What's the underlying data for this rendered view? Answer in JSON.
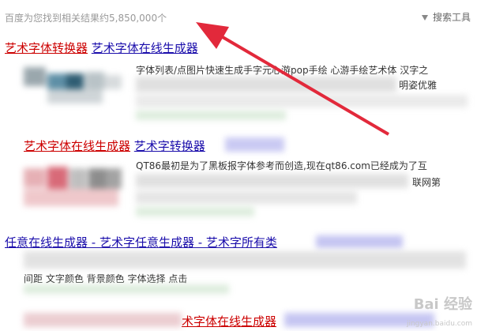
{
  "header": {
    "result_count": "百度为您找到相关结果约5,850,000个",
    "search_tools": "搜索工具"
  },
  "results": [
    {
      "title_part1": "艺术字体转换器",
      "title_part2": "艺术字体在线生成器",
      "snippet_line1": "字体列表/点图片快速生成手字元心游pop手绘 心游手绘艺术体 汉字之",
      "snippet_line2": "明姿优雅"
    },
    {
      "title_part1": "艺术字体在线生成器",
      "title_part2": "艺术字转换器",
      "snippet_line1": "QT86最初是为了黑板报字体参考而创造,现在qt86.com已经成为了互",
      "snippet_line2": "联网第"
    },
    {
      "title": "任意在线生成器 - 艺术字任意生成器 - 艺术字所有类",
      "snippet_line1": "间距 文字颜色 背景颜色 字体选择 点击"
    },
    {
      "title": "术字体在线生成器"
    }
  ],
  "watermark": {
    "brand": "Bai 经验",
    "url": "jingyan.baidu.com"
  },
  "colors": {
    "arrow": "#e2293b",
    "link_red": "#cc0000",
    "link_blue": "#1a0dab"
  }
}
